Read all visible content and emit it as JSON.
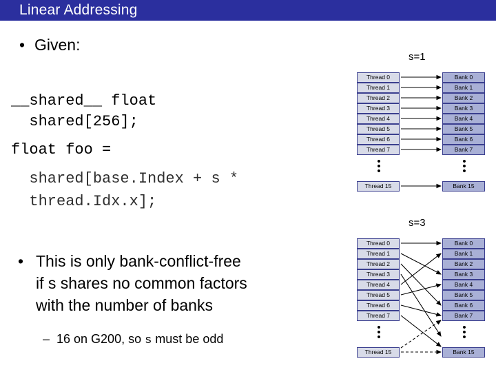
{
  "slide": {
    "title": "Linear Addressing",
    "bullets": {
      "given_label": "Given:",
      "code_lines": [
        "__shared__ float",
        "  shared[256];",
        "float foo =",
        "  shared[base.Index + s *",
        "  thread.Idx.x];"
      ],
      "point2_line1": "This is only bank-conflict-free",
      "point2_line2": "if s shares no common factors",
      "point2_line3": "with the number of banks",
      "sub_point_prefix": "16 on G200, so ",
      "sub_point_mono": "s",
      "sub_point_suffix": " must be odd",
      "bullet_glyph": "•",
      "dash_glyph": "–"
    },
    "diagrams": [
      {
        "label": "s=1",
        "threads": [
          "Thread 0",
          "Thread 1",
          "Thread 2",
          "Thread 3",
          "Thread 4",
          "Thread 5",
          "Thread 6",
          "Thread 7"
        ],
        "thread_last": "Thread 15",
        "banks": [
          "Bank 0",
          "Bank 1",
          "Bank 2",
          "Bank 3",
          "Bank 4",
          "Bank 5",
          "Bank 6",
          "Bank 7"
        ],
        "bank_last": "Bank 15",
        "ellipsis": "•••"
      },
      {
        "label": "s=3",
        "threads": [
          "Thread 0",
          "Thread 1",
          "Thread 2",
          "Thread 3",
          "Thread 4",
          "Thread 5",
          "Thread 6",
          "Thread 7"
        ],
        "thread_last": "Thread 15",
        "banks": [
          "Bank 0",
          "Bank 1",
          "Bank 2",
          "Bank 3",
          "Bank 4",
          "Bank 5",
          "Bank 6",
          "Bank 7"
        ],
        "bank_last": "Bank 15",
        "ellipsis": "•••"
      }
    ],
    "colors": {
      "title_bar": "#2b2f9e",
      "thread_cell": "#d8dbe8",
      "bank_cell": "#a9b0d6",
      "cell_border": "#3b3f8f"
    }
  }
}
